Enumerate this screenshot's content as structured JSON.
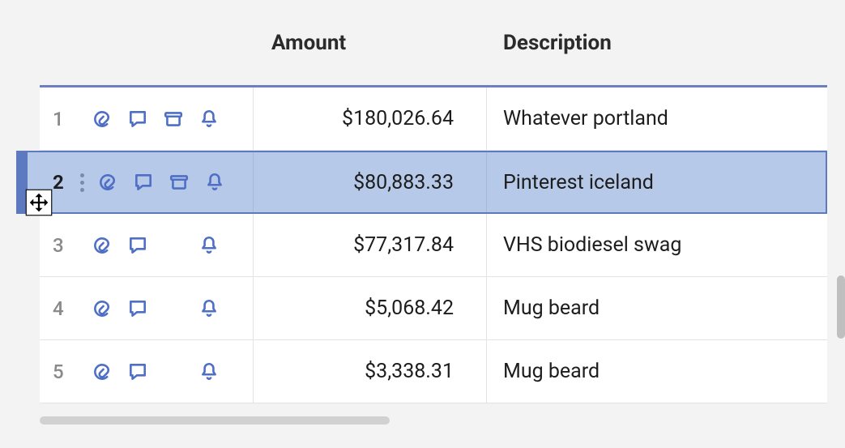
{
  "columns": {
    "amount": "Amount",
    "description": "Description"
  },
  "rows": [
    {
      "num": "1",
      "amount": "$180,026.64",
      "description": "Whatever portland",
      "selected": false,
      "has_archive": true,
      "has_kebab": false
    },
    {
      "num": "2",
      "amount": "$80,883.33",
      "description": "Pinterest iceland",
      "selected": true,
      "has_archive": true,
      "has_kebab": true
    },
    {
      "num": "3",
      "amount": "$77,317.84",
      "description": "VHS biodiesel swag",
      "selected": false,
      "has_archive": false,
      "has_kebab": false
    },
    {
      "num": "4",
      "amount": "$5,068.42",
      "description": "Mug beard",
      "selected": false,
      "has_archive": false,
      "has_kebab": false
    },
    {
      "num": "5",
      "amount": "$3,338.31",
      "description": "Mug beard",
      "selected": false,
      "has_archive": false,
      "has_kebab": false
    }
  ]
}
